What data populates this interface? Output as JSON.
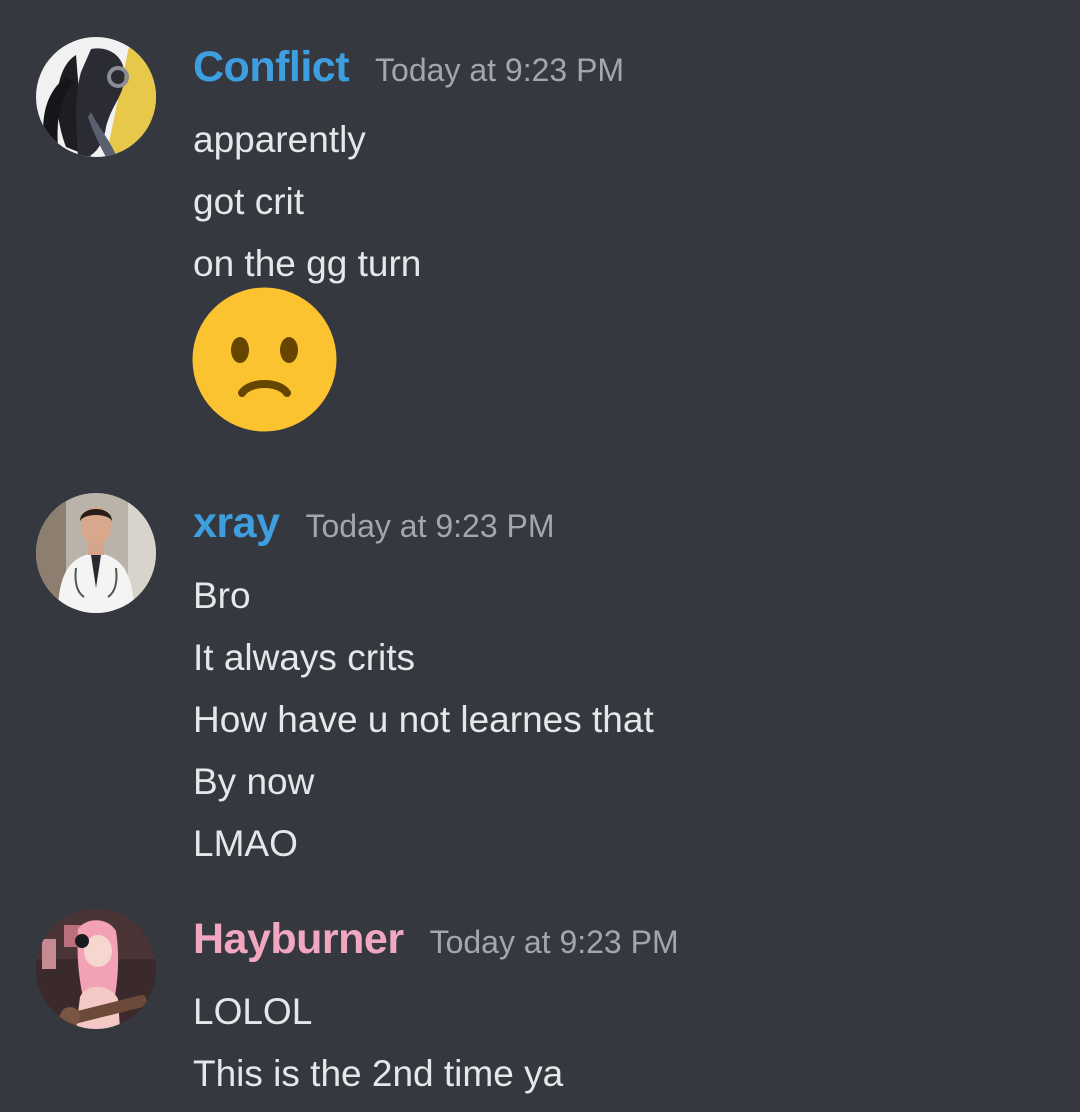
{
  "messages": [
    {
      "author": "Conflict",
      "author_color": "#3e9fe0",
      "timestamp": "Today at 9:23 PM",
      "lines": [
        "apparently",
        "got crit",
        "on the gg turn"
      ],
      "emoji": "frowning-face",
      "avatar_icon": "dark-figure-with-headphones"
    },
    {
      "author": "xray",
      "author_color": "#3e9fe0",
      "timestamp": "Today at 9:23 PM",
      "lines": [
        "Bro",
        "It always crits",
        "How have u not learnes that",
        "By now",
        "LMAO"
      ],
      "avatar_icon": "man-in-white-coat"
    },
    {
      "author": "Hayburner",
      "author_color": "#f1a7bf",
      "timestamp": "Today at 9:23 PM",
      "lines": [
        "LOLOL",
        "This is the 2nd time ya"
      ],
      "avatar_icon": "pink-haired-guitarist"
    }
  ]
}
